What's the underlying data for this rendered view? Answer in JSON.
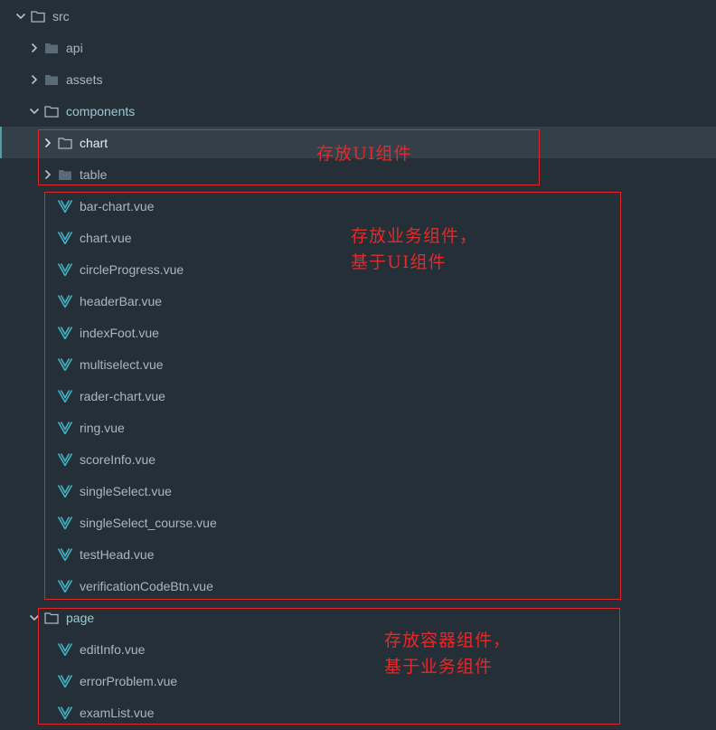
{
  "tree": {
    "src": "src",
    "api": "api",
    "assets": "assets",
    "components": "components",
    "chart": "chart",
    "table": "table",
    "component_files": [
      "bar-chart.vue",
      "chart.vue",
      "circleProgress.vue",
      "headerBar.vue",
      "indexFoot.vue",
      "multiselect.vue",
      "rader-chart.vue",
      "ring.vue",
      "scoreInfo.vue",
      "singleSelect.vue",
      "singleSelect_course.vue",
      "testHead.vue",
      "verificationCodeBtn.vue"
    ],
    "page": "page",
    "page_files": [
      "editInfo.vue",
      "errorProblem.vue",
      "examList.vue"
    ]
  },
  "annotations": {
    "ui_components": "存放UI组件",
    "business_components_line1": "存放业务组件，",
    "business_components_line2": "基于UI组件",
    "container_components_line1": "存放容器组件，",
    "container_components_line2": "基于业务组件"
  },
  "colors": {
    "background": "#252f37",
    "selected_row": "#334049",
    "vue_icon": "#41b3c4",
    "annotation": "#e02727"
  }
}
